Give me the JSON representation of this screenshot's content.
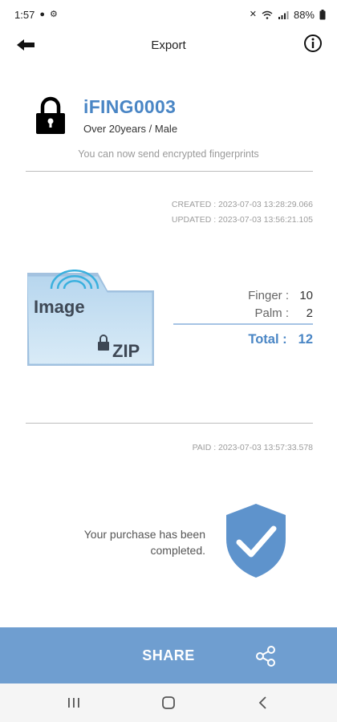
{
  "status_bar": {
    "time": "1:57",
    "battery": "88%"
  },
  "app_bar": {
    "title": "Export",
    "back_icon": "back-arrow-icon",
    "info_icon": "info-icon"
  },
  "user": {
    "id": "iFING0003",
    "subtitle": "Over 20years / Male",
    "message": "You can now send encrypted fingerprints"
  },
  "timestamps": {
    "created": "CREATED : 2023-07-03 13:28:29.066",
    "updated": "UPDATED : 2023-07-03 13:56:21.105",
    "paid": "PAID : 2023-07-03 13:57:33.578"
  },
  "graphic": {
    "image_text": "Image",
    "zip_text": "ZIP"
  },
  "counts": {
    "finger_label": "Finger :",
    "finger_value": "10",
    "palm_label": "Palm :",
    "palm_value": "2",
    "total_label": "Total :",
    "total_value": "12"
  },
  "purchase": {
    "line1": "Your purchase has been",
    "line2": "completed."
  },
  "share": {
    "label": "SHARE"
  },
  "colors": {
    "accent": "#4a86c5",
    "share_bar": "#6f9ed0",
    "shield": "#5e93cc"
  }
}
